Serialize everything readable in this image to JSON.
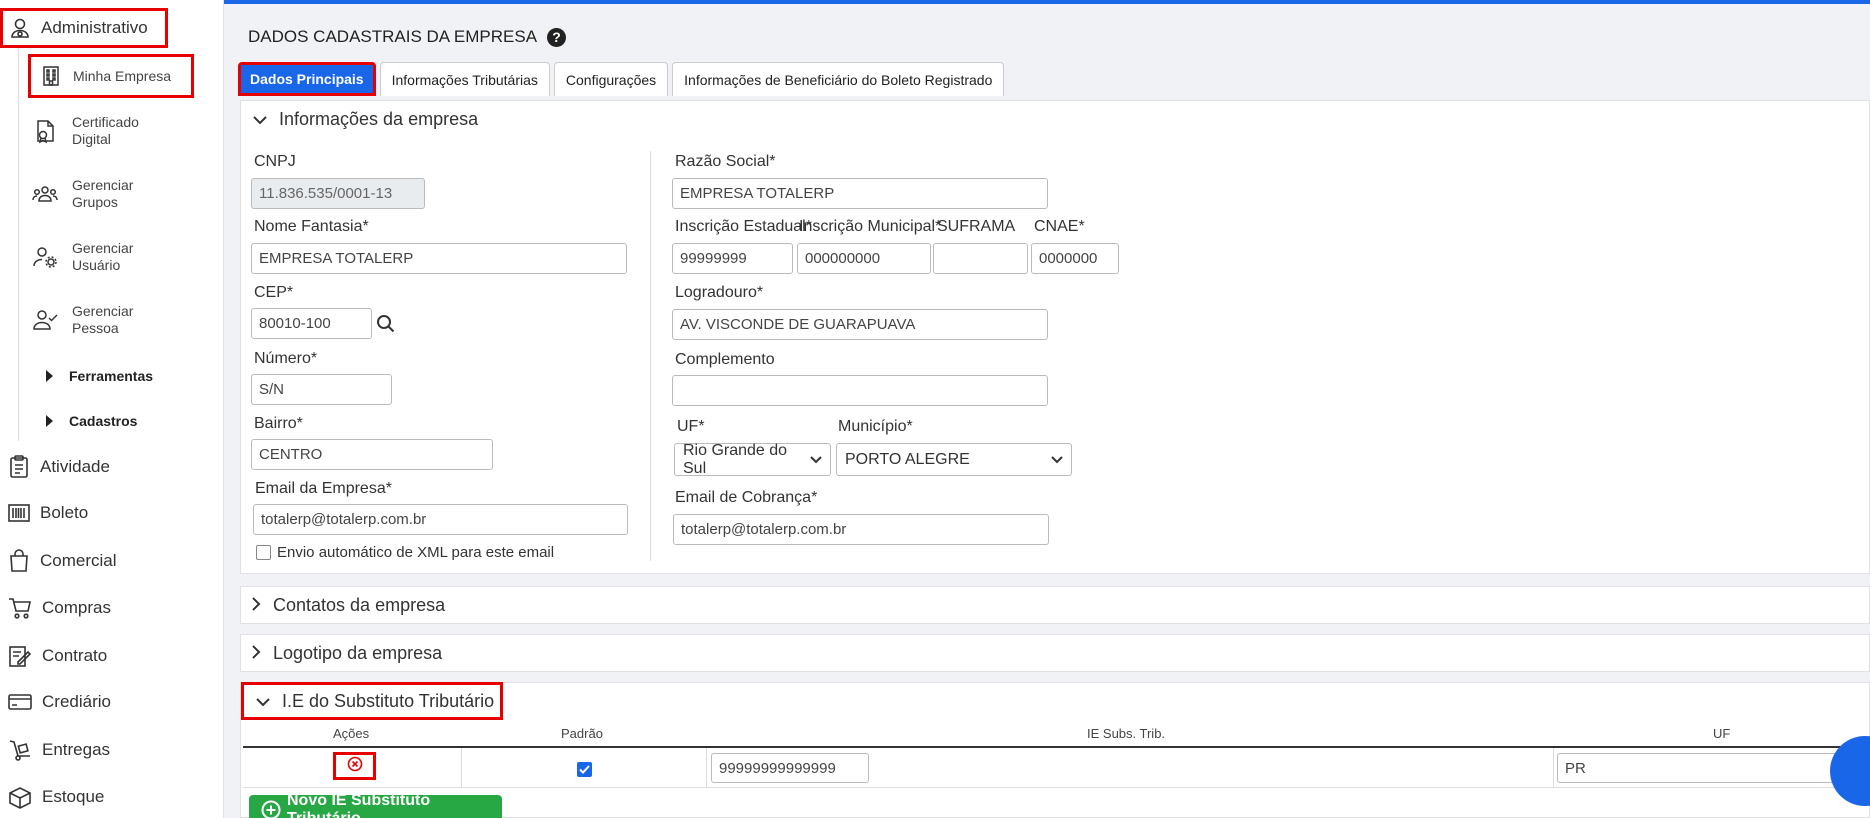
{
  "sidebar": {
    "top": {
      "label": "Administrativo",
      "icon": "user-cog-icon"
    },
    "sub_items": [
      {
        "label": "Minha Empresa",
        "icon": "building-icon"
      },
      {
        "label": "Certificado Digital",
        "icon": "certificate-icon"
      },
      {
        "label": "Gerenciar Grupos",
        "icon": "users-group-icon"
      },
      {
        "label": "Gerenciar Usuário",
        "icon": "user-settings-icon"
      },
      {
        "label": "Gerenciar Pessoa",
        "icon": "user-check-icon"
      }
    ],
    "groups": [
      {
        "label": "Ferramentas"
      },
      {
        "label": "Cadastros"
      }
    ],
    "main_items": [
      {
        "label": "Atividade",
        "icon": "clipboard-icon"
      },
      {
        "label": "Boleto",
        "icon": "barcode-icon"
      },
      {
        "label": "Comercial",
        "icon": "shopping-bag-icon"
      },
      {
        "label": "Compras",
        "icon": "cart-icon"
      },
      {
        "label": "Contrato",
        "icon": "contract-icon"
      },
      {
        "label": "Crediário",
        "icon": "credit-card-icon"
      },
      {
        "label": "Entregas",
        "icon": "hand-truck-icon"
      },
      {
        "label": "Estoque",
        "icon": "box-icon"
      }
    ]
  },
  "page": {
    "title": "DADOS CADASTRAIS DA EMPRESA",
    "help_icon": "question-circle-icon"
  },
  "tabs": [
    {
      "label": "Dados Principais",
      "active": true
    },
    {
      "label": "Informações Tributárias"
    },
    {
      "label": "Configurações"
    },
    {
      "label": "Informações de Beneficiário do Boleto Registrado"
    }
  ],
  "empresa_panel": {
    "title": "Informações da empresa",
    "cnpj_label": "CNPJ",
    "cnpj_value": "11.836.535/0001-13",
    "nome_fantasia_label": "Nome Fantasia*",
    "nome_fantasia_value": "EMPRESA TOTALERP",
    "cep_label": "CEP*",
    "cep_value": "80010-100",
    "numero_label": "Número*",
    "numero_value": "S/N",
    "bairro_label": "Bairro*",
    "bairro_value": "CENTRO",
    "email_label": "Email da Empresa*",
    "email_value": "totalerp@totalerp.com.br",
    "envio_xml_label": "Envio automático de XML para este email",
    "razao_social_label": "Razão Social*",
    "razao_social_value": "EMPRESA TOTALERP",
    "ie_label": "Inscrição Estadual*",
    "ie_value": "99999999",
    "im_label": "Inscrição Municipal*",
    "im_value": "000000000",
    "suframa_label": "SUFRAMA",
    "suframa_value": "",
    "cnae_label": "CNAE*",
    "cnae_value": "0000000",
    "logradouro_label": "Logradouro*",
    "logradouro_value": "AV. VISCONDE DE GUARAPUAVA",
    "complemento_label": "Complemento",
    "complemento_value": "",
    "uf_label": "UF*",
    "uf_value": "Rio Grande do Sul",
    "municipio_label": "Município*",
    "municipio_value": "PORTO ALEGRE",
    "email_cobranca_label": "Email de Cobrança*",
    "email_cobranca_value": "totalerp@totalerp.com.br"
  },
  "contatos_panel": {
    "title": "Contatos da empresa"
  },
  "logotipo_panel": {
    "title": "Logotipo da empresa"
  },
  "ie_st_panel": {
    "title": "I.E do Substituto Tributário",
    "columns": [
      "Ações",
      "Padrão",
      "IE Subs. Trib.",
      "UF"
    ],
    "rows": [
      {
        "padrao": true,
        "ie": "99999999999999",
        "uf": "PR"
      }
    ],
    "add_button_label": "Novo IE Substituto Tributário"
  },
  "colors": {
    "accent": "#1a66e8",
    "highlight": "#e60000",
    "success": "#28a745"
  }
}
